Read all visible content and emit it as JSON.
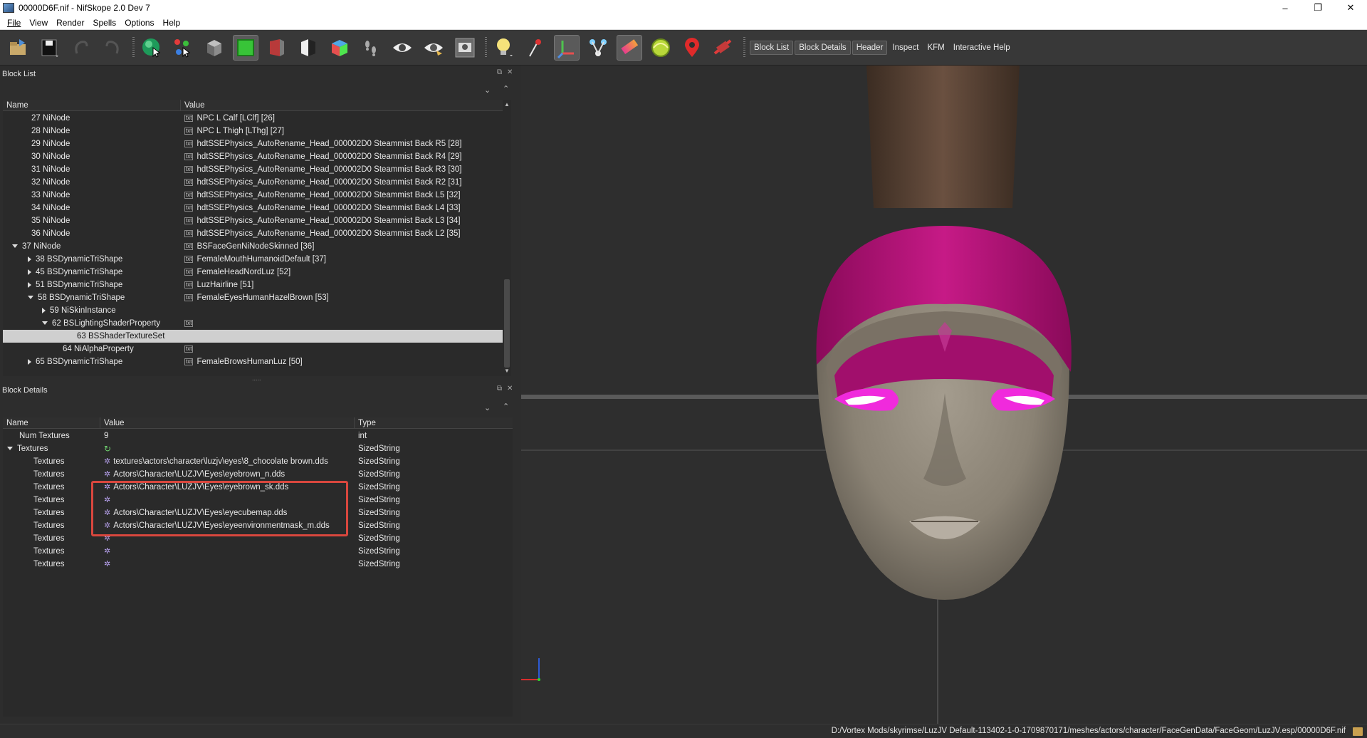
{
  "window": {
    "title": "00000D6F.nif - NifSkope 2.0 Dev 7",
    "minimize": "–",
    "maximize": "❐",
    "close": "✕"
  },
  "menu": [
    "File",
    "View",
    "Render",
    "Spells",
    "Options",
    "Help"
  ],
  "toolbar": {
    "text_buttons": [
      "Block List",
      "Block Details",
      "Header",
      "Inspect",
      "KFM",
      "Interactive Help"
    ]
  },
  "block_list": {
    "title": "Block List",
    "columns": [
      "Name",
      "Value"
    ],
    "rows": [
      {
        "name": "27 NiNode",
        "value": "NPC L Calf [LClf] [26]"
      },
      {
        "name": "28 NiNode",
        "value": "NPC L Thigh [LThg] [27]"
      },
      {
        "name": "29 NiNode",
        "value": "hdtSSEPhysics_AutoRename_Head_000002D0 Steammist Back R5 [28]"
      },
      {
        "name": "30 NiNode",
        "value": "hdtSSEPhysics_AutoRename_Head_000002D0 Steammist Back R4 [29]"
      },
      {
        "name": "31 NiNode",
        "value": "hdtSSEPhysics_AutoRename_Head_000002D0 Steammist Back R3 [30]"
      },
      {
        "name": "32 NiNode",
        "value": "hdtSSEPhysics_AutoRename_Head_000002D0 Steammist Back R2 [31]"
      },
      {
        "name": "33 NiNode",
        "value": "hdtSSEPhysics_AutoRename_Head_000002D0 Steammist Back L5 [32]"
      },
      {
        "name": "34 NiNode",
        "value": "hdtSSEPhysics_AutoRename_Head_000002D0 Steammist Back L4 [33]"
      },
      {
        "name": "35 NiNode",
        "value": "hdtSSEPhysics_AutoRename_Head_000002D0 Steammist Back L3 [34]"
      },
      {
        "name": "36 NiNode",
        "value": "hdtSSEPhysics_AutoRename_Head_000002D0 Steammist Back L2 [35]"
      },
      {
        "name": "37 NiNode",
        "value": "BSFaceGenNiNodeSkinned [36]"
      },
      {
        "name": "38 BSDynamicTriShape",
        "value": "FemaleMouthHumanoidDefault [37]"
      },
      {
        "name": "45 BSDynamicTriShape",
        "value": "FemaleHeadNordLuz [52]"
      },
      {
        "name": "51 BSDynamicTriShape",
        "value": "LuzHairline [51]"
      },
      {
        "name": "58 BSDynamicTriShape",
        "value": "FemaleEyesHumanHazelBrown [53]"
      },
      {
        "name": "59 NiSkinInstance",
        "value": ""
      },
      {
        "name": "62 BSLightingShaderProperty",
        "value": ""
      },
      {
        "name": "63 BSShaderTextureSet",
        "value": ""
      },
      {
        "name": "64 NiAlphaProperty",
        "value": ""
      },
      {
        "name": "65 BSDynamicTriShape",
        "value": "FemaleBrowsHumanLuz [50]"
      }
    ]
  },
  "block_details": {
    "title": "Block Details",
    "columns": [
      "Name",
      "Value",
      "Type"
    ],
    "rows": [
      {
        "name": "Num Textures",
        "value": "9",
        "type": "int"
      },
      {
        "name": "Textures",
        "value": "",
        "type": "SizedString"
      },
      {
        "name": "Textures",
        "value": "textures\\actors\\character\\luzjv\\eyes\\8_chocolate brown.dds",
        "type": "SizedString"
      },
      {
        "name": "Textures",
        "value": "Actors\\Character\\LUZJV\\Eyes\\eyebrown_n.dds",
        "type": "SizedString"
      },
      {
        "name": "Textures",
        "value": "Actors\\Character\\LUZJV\\Eyes\\eyebrown_sk.dds",
        "type": "SizedString"
      },
      {
        "name": "Textures",
        "value": "",
        "type": "SizedString"
      },
      {
        "name": "Textures",
        "value": "Actors\\Character\\LUZJV\\Eyes\\eyecubemap.dds",
        "type": "SizedString"
      },
      {
        "name": "Textures",
        "value": "Actors\\Character\\LUZJV\\Eyes\\eyeenvironmentmask_m.dds",
        "type": "SizedString"
      },
      {
        "name": "Textures",
        "value": "",
        "type": "SizedString"
      },
      {
        "name": "Textures",
        "value": "",
        "type": "SizedString"
      },
      {
        "name": "Textures",
        "value": "",
        "type": "SizedString"
      }
    ]
  },
  "status": {
    "path": "D:/Vortex Mods/skyrimse/LuzJV Default-113402-1-0-1709870171/meshes/actors/character/FaceGenData/FaceGeom/LuzJV.esp/00000D6F.nif"
  }
}
